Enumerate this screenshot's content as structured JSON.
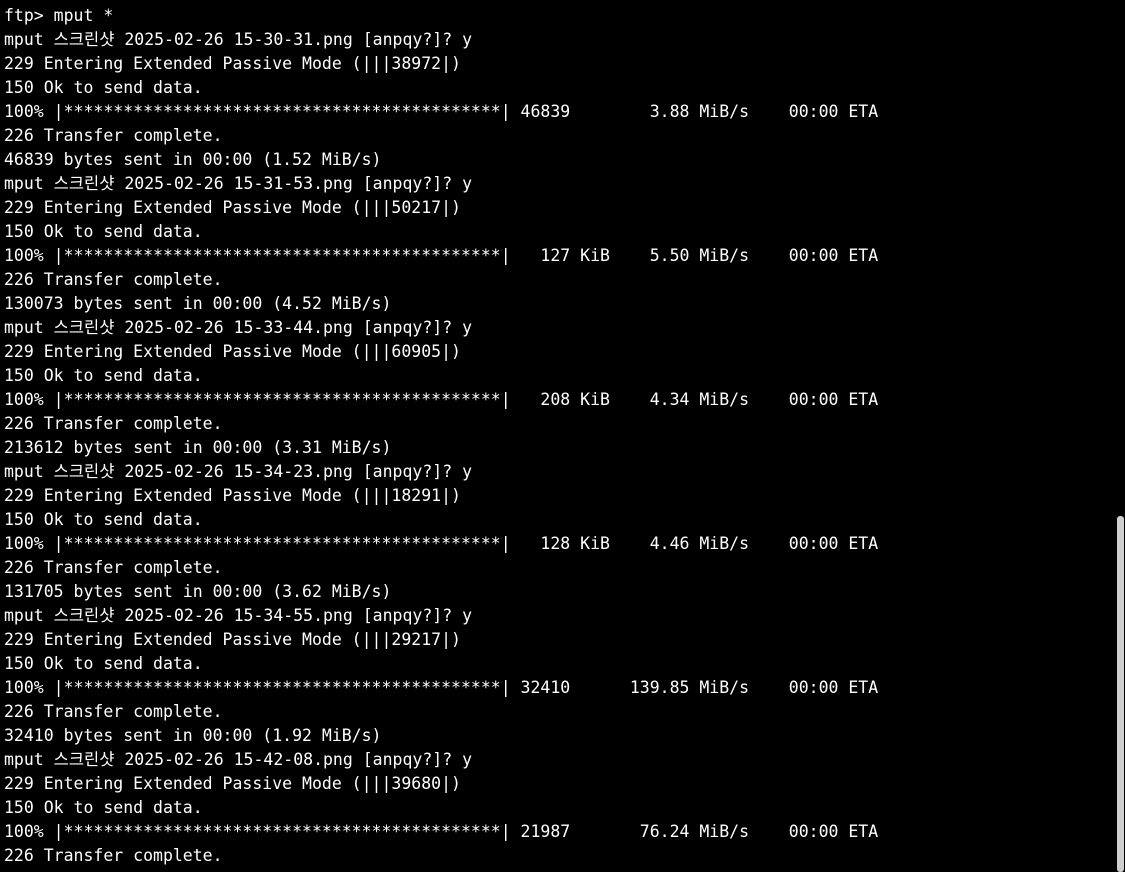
{
  "terminal": {
    "lines": [
      "ftp> mput *",
      "mput 스크린샷 2025-02-26 15-30-31.png [anpqy?]? y",
      "229 Entering Extended Passive Mode (|||38972|)",
      "150 Ok to send data.",
      "100% |********************************************| 46839        3.88 MiB/s    00:00 ETA",
      "226 Transfer complete.",
      "46839 bytes sent in 00:00 (1.52 MiB/s)",
      "mput 스크린샷 2025-02-26 15-31-53.png [anpqy?]? y",
      "229 Entering Extended Passive Mode (|||50217|)",
      "150 Ok to send data.",
      "100% |********************************************|   127 KiB    5.50 MiB/s    00:00 ETA",
      "226 Transfer complete.",
      "130073 bytes sent in 00:00 (4.52 MiB/s)",
      "mput 스크린샷 2025-02-26 15-33-44.png [anpqy?]? y",
      "229 Entering Extended Passive Mode (|||60905|)",
      "150 Ok to send data.",
      "100% |********************************************|   208 KiB    4.34 MiB/s    00:00 ETA",
      "226 Transfer complete.",
      "213612 bytes sent in 00:00 (3.31 MiB/s)",
      "mput 스크린샷 2025-02-26 15-34-23.png [anpqy?]? y",
      "229 Entering Extended Passive Mode (|||18291|)",
      "150 Ok to send data.",
      "100% |********************************************|   128 KiB    4.46 MiB/s    00:00 ETA",
      "226 Transfer complete.",
      "131705 bytes sent in 00:00 (3.62 MiB/s)",
      "mput 스크린샷 2025-02-26 15-34-55.png [anpqy?]? y",
      "229 Entering Extended Passive Mode (|||29217|)",
      "150 Ok to send data.",
      "100% |********************************************| 32410      139.85 MiB/s    00:00 ETA",
      "226 Transfer complete.",
      "32410 bytes sent in 00:00 (1.92 MiB/s)",
      "mput 스크린샷 2025-02-26 15-42-08.png [anpqy?]? y",
      "229 Entering Extended Passive Mode (|||39680|)",
      "150 Ok to send data.",
      "100% |********************************************| 21987       76.24 MiB/s    00:00 ETA",
      "226 Transfer complete."
    ]
  },
  "colors": {
    "background": "#000000",
    "foreground": "#ffffff",
    "scrollbar_thumb": "#cfcfcf"
  }
}
